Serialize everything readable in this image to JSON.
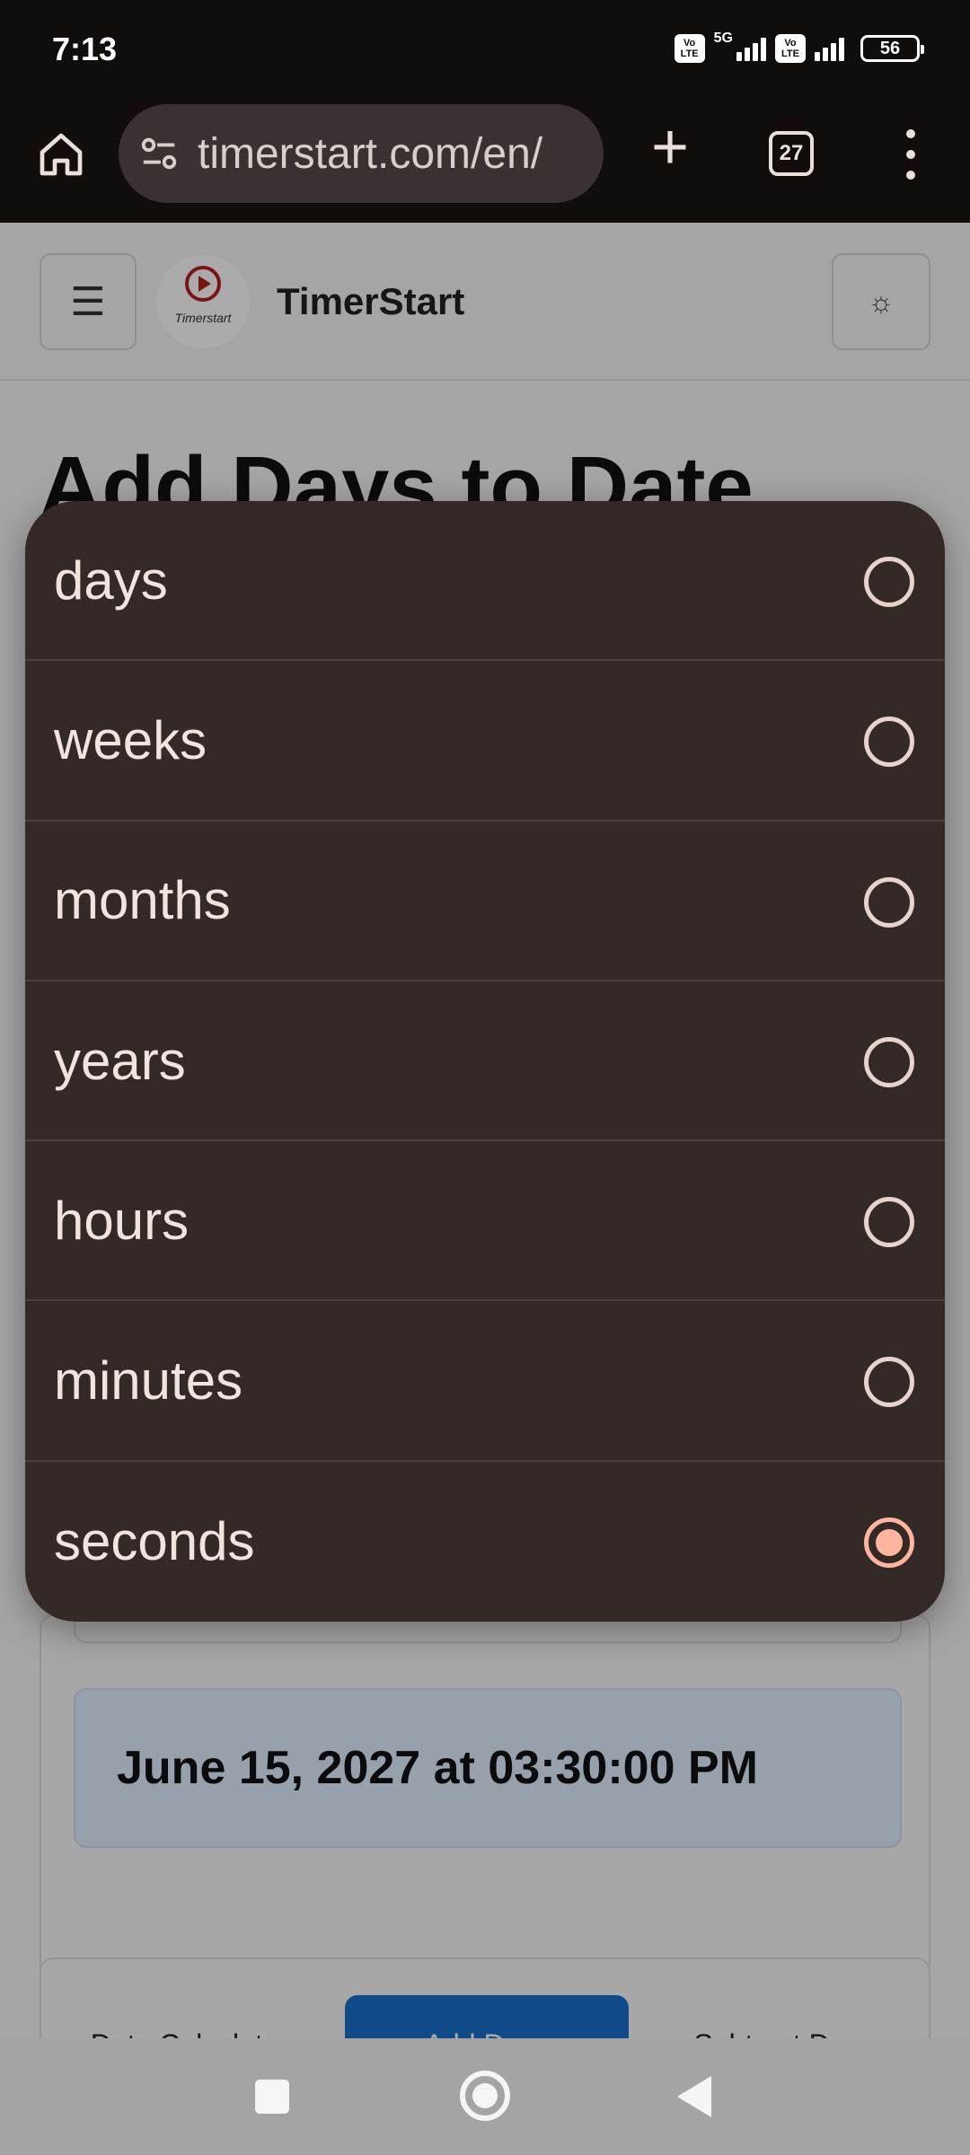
{
  "status_bar": {
    "time": "7:13",
    "network": "5G",
    "volte_label": "Vo LTE",
    "battery": "56"
  },
  "browser": {
    "url": "timerstart.com/en/",
    "tab_count": "27"
  },
  "site": {
    "name": "TimerStart",
    "logo_text": "Timerstart",
    "menu_icon": "☰",
    "theme_icon": "☼"
  },
  "page": {
    "title": "Add Days to Date",
    "result": "June 15, 2027 at 03:30:00 PM"
  },
  "tabs": [
    {
      "label": "Date Calculator",
      "active": false
    },
    {
      "label": "Add Days",
      "active": true
    },
    {
      "label": "Subtract Days",
      "active": false
    }
  ],
  "picker": {
    "options": [
      {
        "label": "days",
        "selected": false
      },
      {
        "label": "weeks",
        "selected": false
      },
      {
        "label": "months",
        "selected": false
      },
      {
        "label": "years",
        "selected": false
      },
      {
        "label": "hours",
        "selected": false
      },
      {
        "label": "minutes",
        "selected": false
      },
      {
        "label": "seconds",
        "selected": true
      }
    ]
  },
  "colors": {
    "accent": "#ffb59e",
    "dialog_bg": "#332926",
    "tab_active": "#1a6fcd",
    "result_bg": "#e2f0ff"
  },
  "icons": [
    "home-icon",
    "site-info-icon",
    "plus-icon",
    "tabs-icon",
    "more-icon",
    "hamburger-icon",
    "sun-icon",
    "recents-icon",
    "home-nav-icon",
    "back-icon"
  ]
}
